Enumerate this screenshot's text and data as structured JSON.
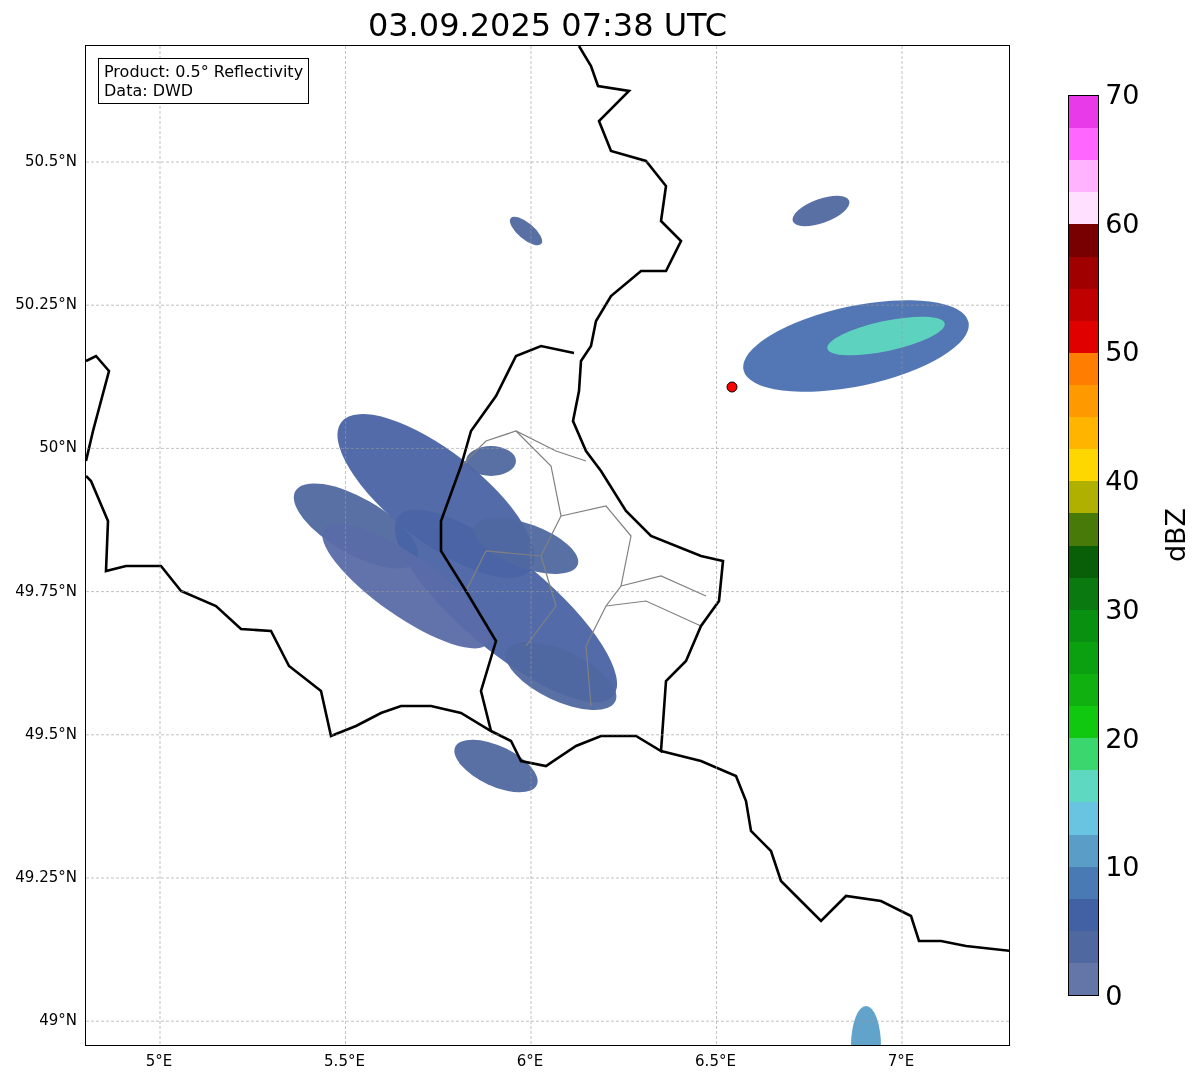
{
  "title": "03.09.2025 07:38 UTC",
  "map": {
    "info_lines": [
      "Product: 0.5° Reflectivity",
      "Data: DWD"
    ],
    "lat_labels": [
      "50.5°N",
      "50.25°N",
      "50°N",
      "49.75°N",
      "49.5°N",
      "49.25°N",
      "49°N"
    ],
    "lon_labels": [
      "5°E",
      "5.5°E",
      "6°E",
      "6.5°E",
      "7°E"
    ]
  },
  "colorbar": {
    "label": "dBZ",
    "ticks": [
      "70",
      "60",
      "50",
      "40",
      "30",
      "20",
      "10",
      "0"
    ],
    "bands": [
      {
        "color": "#e83ae8"
      },
      {
        "color": "#ff66ff"
      },
      {
        "color": "#ffb3ff"
      },
      {
        "color": "#ffe0ff"
      },
      {
        "color": "#780000"
      },
      {
        "color": "#a00000"
      },
      {
        "color": "#c00000"
      },
      {
        "color": "#e00000"
      },
      {
        "color": "#ff7d00"
      },
      {
        "color": "#ff9900"
      },
      {
        "color": "#ffb400"
      },
      {
        "color": "#ffd700"
      },
      {
        "color": "#b0b000"
      },
      {
        "color": "#487a0a"
      },
      {
        "color": "#085f08"
      },
      {
        "color": "#0a7a10"
      },
      {
        "color": "#0a9010"
      },
      {
        "color": "#0aa010"
      },
      {
        "color": "#10b010"
      },
      {
        "color": "#10c810"
      },
      {
        "color": "#3cd66e"
      },
      {
        "color": "#5ed8c0"
      },
      {
        "color": "#68c4e0"
      },
      {
        "color": "#5a9ec8"
      },
      {
        "color": "#4a7ab4"
      },
      {
        "color": "#4260a4"
      },
      {
        "color": "#5068a0"
      },
      {
        "color": "#6476a8"
      }
    ]
  }
}
